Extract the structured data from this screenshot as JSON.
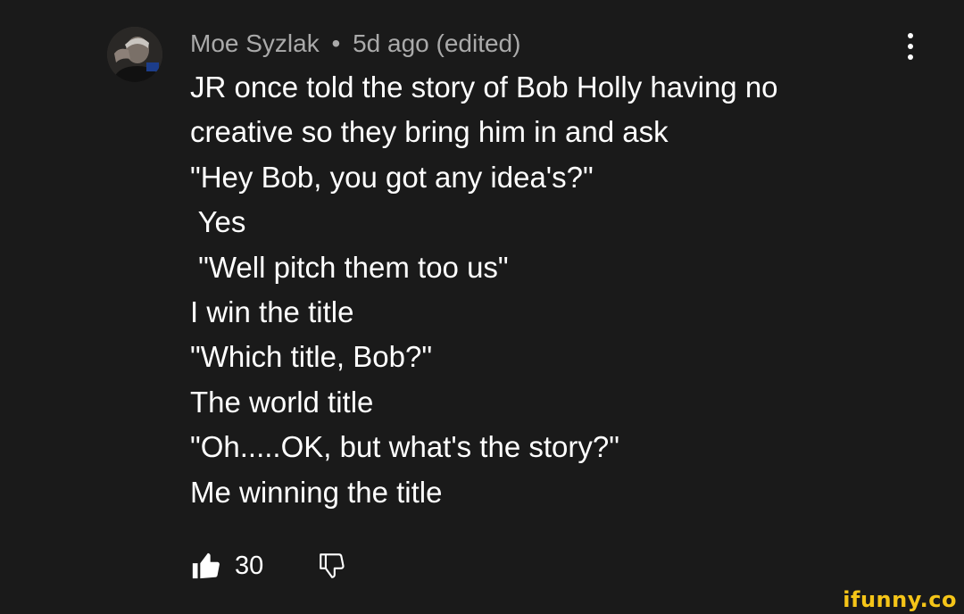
{
  "comment": {
    "author": "Moe Syzlak",
    "separator": "•",
    "time": "5d ago (edited)",
    "lines": [
      "JR once told the story of Bob Holly having no",
      "creative so they bring him in and ask",
      "\"Hey Bob, you got any idea's?\"",
      " Yes",
      " \"Well pitch them too us\"",
      "I win the title",
      "\"Which title, Bob?\"",
      "The world title",
      "\"Oh.....OK, but what's the story?\"",
      "Me winning the title"
    ],
    "like_count": "30"
  },
  "icons": {
    "avatar": "profile-photo",
    "more": "vertical-ellipsis-icon",
    "like": "thumbs-up-filled-icon",
    "dislike": "thumbs-down-outline-icon"
  },
  "watermark": "ifunny.co",
  "colors": {
    "background": "#1a1a1a",
    "text": "#ffffff",
    "meta_text": "#aaaaaa",
    "watermark": "#f5c518"
  }
}
